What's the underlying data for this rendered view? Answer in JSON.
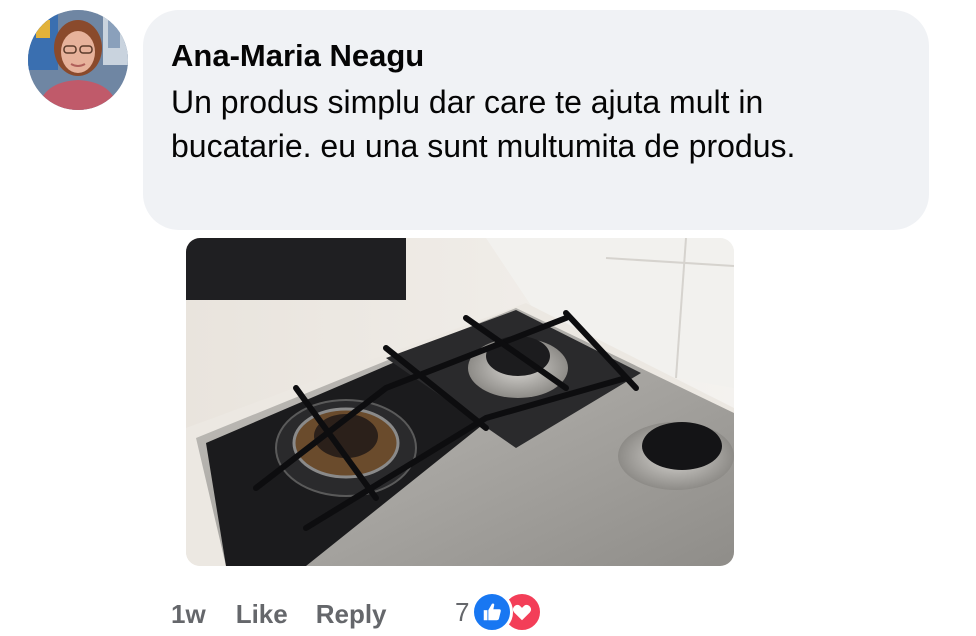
{
  "comment": {
    "author": "Ana-Maria Neagu",
    "text": "Un produs simplu dar care te ajuta mult in bucatarie. eu una sunt multumita de produs.",
    "timestamp": "1w",
    "like_label": "Like",
    "reply_label": "Reply",
    "reaction_count": "7",
    "reactions": [
      "like-icon",
      "love-icon"
    ]
  },
  "colors": {
    "bubble_bg": "#f0f2f5",
    "text": "#050505",
    "meta_text": "#65676b",
    "like_blue": "#1877f2",
    "love_red": "#f33e58"
  }
}
